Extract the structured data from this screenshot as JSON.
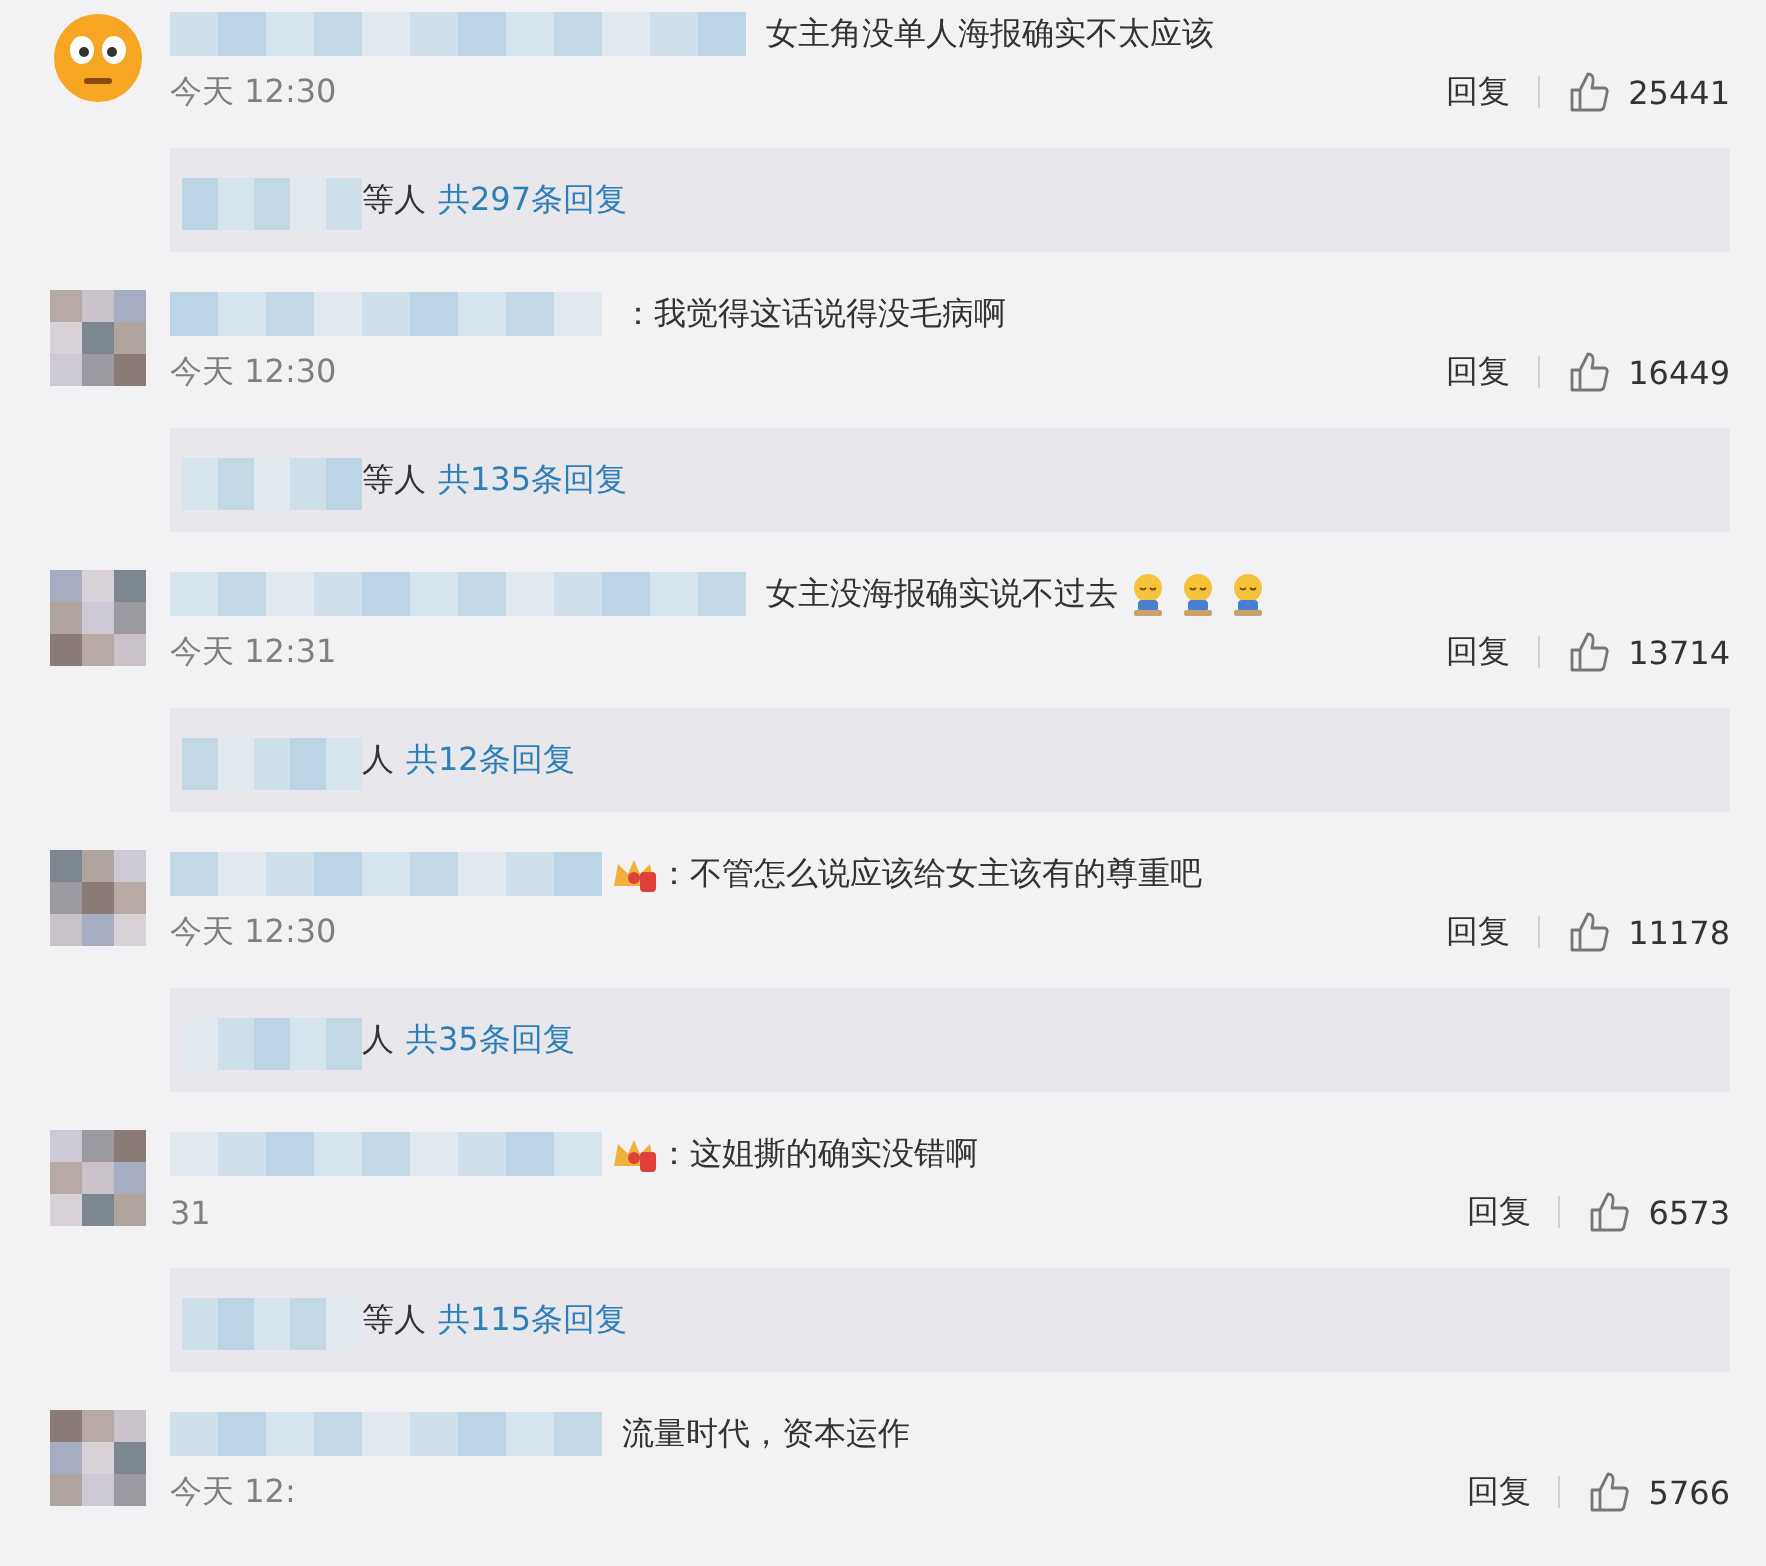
{
  "comments": [
    {
      "avatar": {
        "kind": "emoji"
      },
      "badge": false,
      "text": "女主角没单人海报确实不太应该",
      "time": "今天 12:30",
      "reply_label": "回复",
      "likes": "25441",
      "replies": {
        "prefix": "等人",
        "link": "共297条回复"
      }
    },
    {
      "avatar": {
        "kind": "mosaic"
      },
      "badge": false,
      "text": "：我觉得这话说得没毛病啊",
      "time": "今天 12:30",
      "reply_label": "回复",
      "likes": "16449",
      "replies": {
        "prefix": "等人",
        "link": "共135条回复"
      }
    },
    {
      "avatar": {
        "kind": "mosaic"
      },
      "badge": false,
      "text": "女主没海报确实说不过去",
      "emojis": [
        {
          "kind": "emoji"
        },
        {
          "kind": "emoji"
        },
        {
          "kind": "emoji"
        }
      ],
      "time": "今天 12:31",
      "reply_label": "回复",
      "likes": "13714",
      "replies": {
        "prefix": "人",
        "link": "共12条回复"
      }
    },
    {
      "avatar": {
        "kind": "mosaic"
      },
      "badge": true,
      "text": "：不管怎么说应该给女主该有的尊重吧",
      "time": "今天 12:30",
      "reply_label": "回复",
      "likes": "11178",
      "replies": {
        "prefix": "人",
        "link": "共35条回复"
      }
    },
    {
      "avatar": {
        "kind": "mosaic"
      },
      "badge": true,
      "text": "：这姐撕的确实没错啊",
      "time": "31",
      "reply_label": "回复",
      "likes": "6573",
      "replies": {
        "prefix": "等人",
        "link": "共115条回复"
      }
    },
    {
      "avatar": {
        "kind": "mosaic"
      },
      "badge": false,
      "text": "流量时代，资本运作",
      "time": "今天 12:",
      "reply_label": "回复",
      "likes": "5766"
    }
  ]
}
